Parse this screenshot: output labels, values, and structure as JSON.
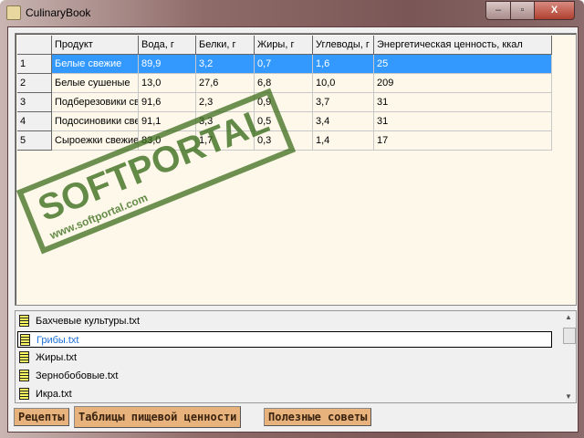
{
  "window": {
    "title": "CulinaryBook",
    "minimize": "–",
    "maximize": "▫",
    "close": "X"
  },
  "table": {
    "headers": [
      "",
      "Продукт",
      "Вода, г",
      "Белки, г",
      "Жиры, г",
      "Углеводы, г",
      "Энергетическая ценность, ккал"
    ],
    "rows": [
      [
        "1",
        "Белые свежие",
        "89,9",
        "3,2",
        "0,7",
        "1,6",
        "25"
      ],
      [
        "2",
        "Белые сушеные",
        "13,0",
        "27,6",
        "6,8",
        "10,0",
        "209"
      ],
      [
        "3",
        "Подберезовики свежие",
        "91,6",
        "2,3",
        "0,9",
        "3,7",
        "31"
      ],
      [
        "4",
        "Подосиновики свежие",
        "91,1",
        "3,3",
        "0,5",
        "3,4",
        "31"
      ],
      [
        "5",
        "Сыроежки свежие",
        "83,0",
        "1,7",
        "0,3",
        "1,4",
        "17"
      ]
    ],
    "selected_row": 0
  },
  "files": {
    "items": [
      "Бахчевые культуры.txt",
      "Грибы.txt",
      "Жиры.txt",
      "Зернобобовые.txt",
      "Икра.txt"
    ],
    "selected": 1
  },
  "tabs": [
    "Рецепты",
    "Таблицы пищевой ценности",
    "Полезные советы"
  ],
  "active_tab": 1,
  "watermark": {
    "text": "SOFTPORTAL",
    "url": "www.softportal.com"
  }
}
